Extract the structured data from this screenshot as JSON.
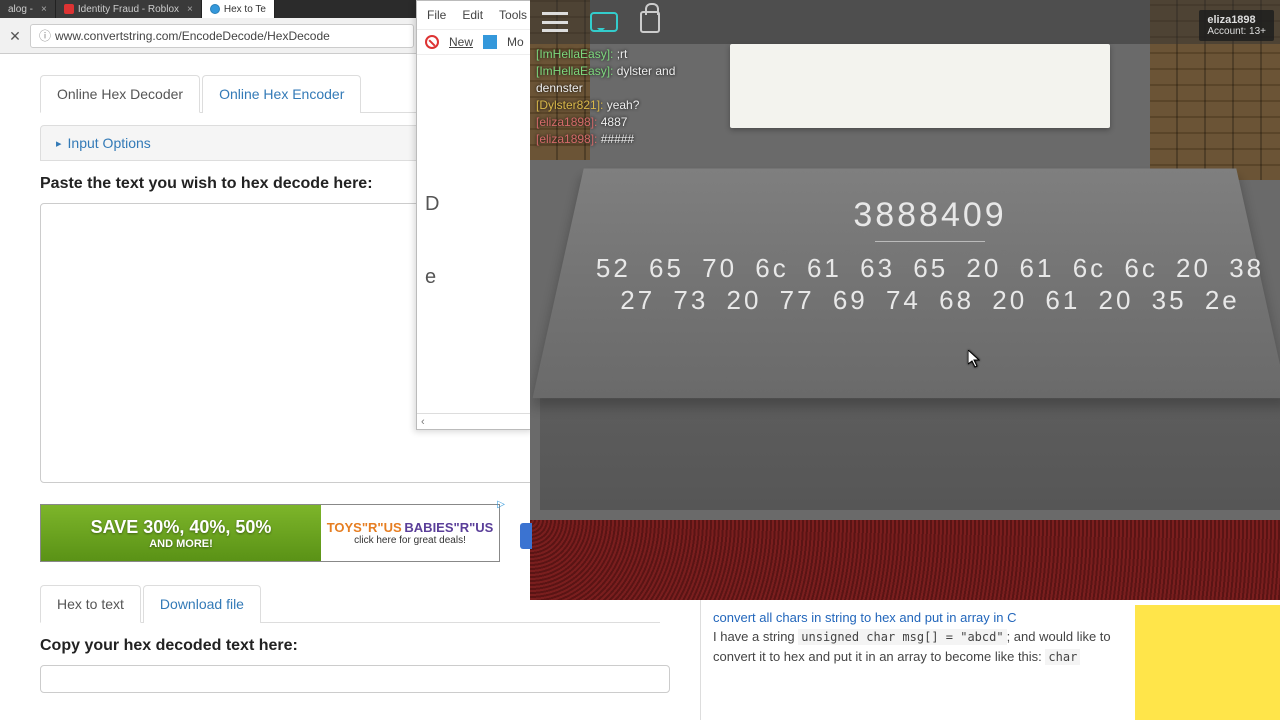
{
  "tabs": {
    "t1": "alog -",
    "t2": "Identity Fraud - Roblox",
    "t3": "Hex to Te"
  },
  "addr": {
    "url": "www.convertstring.com/EncodeDecode/HexDecode"
  },
  "page": {
    "tab_decoder": "Online Hex Decoder",
    "tab_encoder": "Online Hex Encoder",
    "input_options": "Input Options",
    "paste_label": "Paste the text you wish to hex decode here:",
    "hex_to_text": "Hex to text",
    "download_file": "Download file",
    "copy_label": "Copy your hex decoded text here:"
  },
  "ad": {
    "big": "SAVE 30%, 40%, 50%",
    "small": "AND MORE!",
    "brand1": "TOYS\"R\"US",
    "brand2": "BABIES\"R\"US",
    "cta": "click here for great deals!"
  },
  "edge": {
    "file": "File",
    "edit": "Edit",
    "tools": "Tools",
    "new_": "New",
    "mo": "Mo",
    "d": "D",
    "e": "e",
    "scroll_hint": "‹"
  },
  "roblox": {
    "account_name": "eliza1898",
    "account_age": "Account: 13+",
    "chat": [
      {
        "user": "[ImHellaEasy]:",
        "cls": "u1",
        "msg": ";rt"
      },
      {
        "user": "[ImHellaEasy]:",
        "cls": "u1",
        "msg": "dylster and"
      },
      {
        "user": "",
        "cls": "",
        "msg": "dennster"
      },
      {
        "user": "[Dylster821]:",
        "cls": "u2",
        "msg": "yeah?"
      },
      {
        "user": "[eliza1898]:",
        "cls": "u3",
        "msg": "4887"
      },
      {
        "user": "[eliza1898]:",
        "cls": "u3",
        "msg": "#####"
      }
    ],
    "display_number": "3888409",
    "hex_line1": "52 65 70 6c 61 63 65 20 61 6c 6c 20 38",
    "hex_line2": "27 73 20 77 69 74 68 20 61 20 35 2e"
  },
  "qa": {
    "link": "convert all chars in string to hex and put in array in C",
    "body1": "I have a string ",
    "code1": "unsigned char msg[] = \"abcd\"",
    "body2": "; and would like to convert it to hex and put it in an array to become like this: ",
    "code2": "char"
  }
}
